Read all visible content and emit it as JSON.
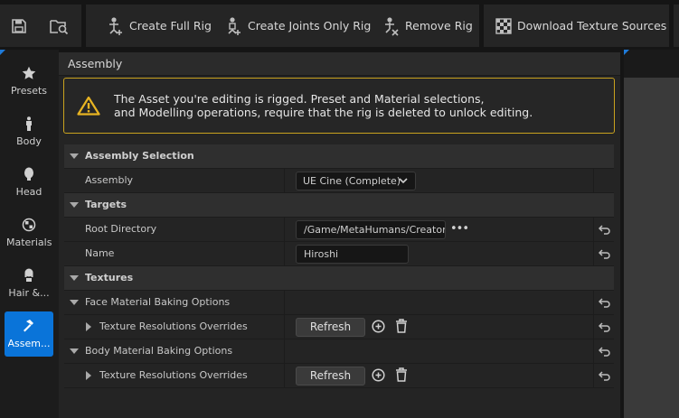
{
  "toolbar": {
    "save_icon": "save-icon",
    "browse_icon": "browse-folder-icon",
    "create_full_rig": "Create Full Rig",
    "create_joints_only_rig": "Create Joints Only Rig",
    "remove_rig": "Remove Rig",
    "download_texture_sources": "Download Texture Sources"
  },
  "nav": {
    "items": [
      {
        "label": "Presets",
        "icon": "star-icon"
      },
      {
        "label": "Body",
        "icon": "body-icon"
      },
      {
        "label": "Head",
        "icon": "head-icon"
      },
      {
        "label": "Materials",
        "icon": "materials-icon"
      },
      {
        "label": "Hair &...",
        "icon": "hair-icon"
      },
      {
        "label": "Assem...",
        "icon": "hammer-icon",
        "active": true
      }
    ]
  },
  "panel": {
    "title": "Assembly",
    "warning_line1": "The Asset you're editing is rigged. Preset and Material selections,",
    "warning_line2": "and Modelling operations, require that the rig is deleted to unlock editing."
  },
  "sections": {
    "assembly_selection": "Assembly Selection",
    "assembly_label": "Assembly",
    "assembly_value": "UE Cine (Complete)",
    "targets": "Targets",
    "root_directory_label": "Root Directory",
    "root_directory_value": "/Game/MetaHumans/Creator",
    "name_label": "Name",
    "name_value": "Hiroshi",
    "textures": "Textures",
    "face_baking": "Face Material Baking Options",
    "face_tex_overrides": "Texture Resolutions Overrides",
    "body_baking": "Body Material Baking Options",
    "body_tex_overrides": "Texture Resolutions Overrides",
    "refresh_label": "Refresh",
    "browse_dots": "•••"
  },
  "colors": {
    "accent": "#0a74d9",
    "warning_border": "#c9a21e"
  }
}
